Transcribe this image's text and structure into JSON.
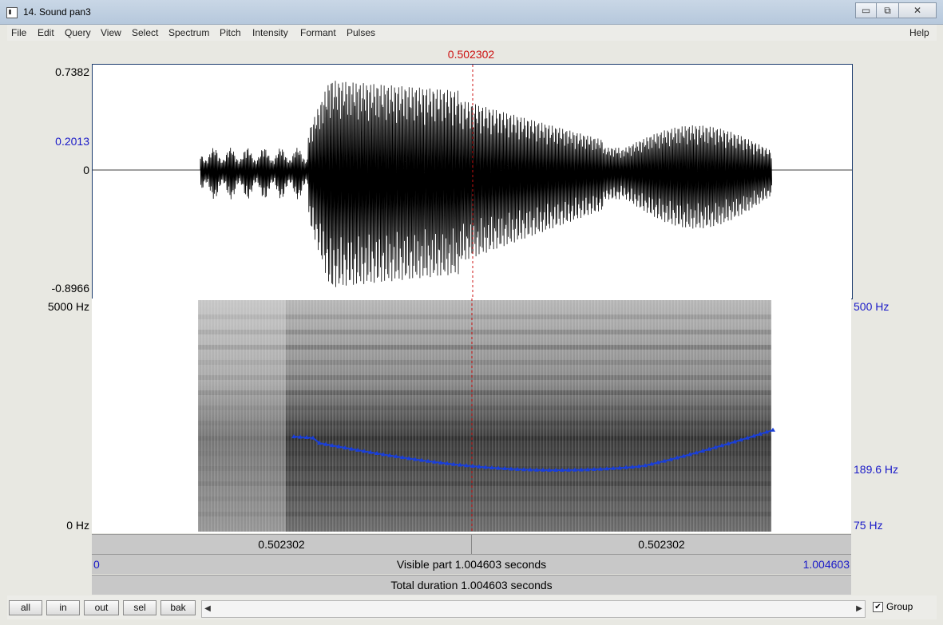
{
  "window": {
    "title": "14. Sound pan3",
    "controls": {
      "minimize": "▭",
      "maximize": "⧉",
      "close": "✕"
    }
  },
  "menu": [
    "File",
    "Edit",
    "Query",
    "View",
    "Select",
    "Spectrum",
    "Pitch",
    "Intensity",
    "Formant",
    "Pulses"
  ],
  "help_label": "Help",
  "cursor_time": "0.502302",
  "waveform": {
    "ymax": "0.7382",
    "ymid": "0.2013",
    "yzero": "0",
    "ymin": "-0.8966"
  },
  "spectrogram": {
    "fmax": "5000 Hz",
    "fmin": "0 Hz",
    "pitch_max": "500 Hz",
    "pitch_cursor": "189.6 Hz",
    "pitch_min": "75 Hz",
    "pitch_color": "#1a3fd8"
  },
  "bars": {
    "left_cursor": "0.502302",
    "right_cursor": "0.502302",
    "start": "0",
    "visible": "Visible part 1.004603 seconds",
    "end": "1.004603",
    "total": "Total duration 1.004603 seconds"
  },
  "buttons": [
    "all",
    "in",
    "out",
    "sel",
    "bak"
  ],
  "group": {
    "label": "Group",
    "checked": true
  }
}
